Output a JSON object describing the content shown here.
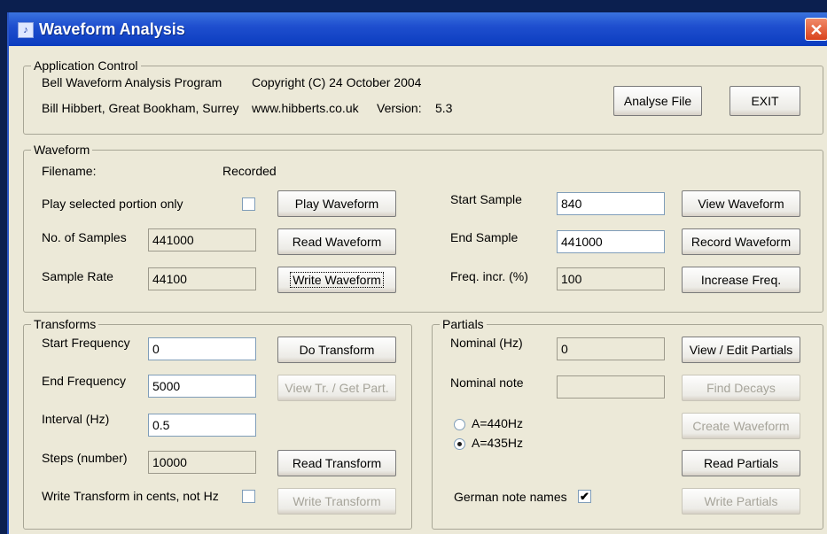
{
  "window": {
    "title": "Waveform Analysis",
    "close_glyph": "✕"
  },
  "app_control": {
    "legend": "Application Control",
    "program_name": "Bell Waveform Analysis Program",
    "copyright": "Copyright (C) 24 October 2004",
    "author": "Bill Hibbert, Great Bookham, Surrey",
    "website": "www.hibberts.co.uk",
    "version_label": "Version:",
    "version_value": "5.3",
    "analyse_button": "Analyse File",
    "exit_button": "EXIT"
  },
  "waveform": {
    "legend": "Waveform",
    "filename_label": "Filename:",
    "filename_value": "Recorded",
    "play_selected_label": "Play selected portion only",
    "play_selected_checked": false,
    "samples_label": "No. of Samples",
    "samples_value": "441000",
    "rate_label": "Sample Rate",
    "rate_value": "44100",
    "play_button": "Play Waveform",
    "read_button": "Read Waveform",
    "write_button": "Write Waveform",
    "start_label": "Start Sample",
    "start_value": "840",
    "end_label": "End Sample",
    "end_value": "441000",
    "freq_incr_label": "Freq. incr. (%)",
    "freq_incr_value": "100",
    "view_button": "View Waveform",
    "record_button": "Record Waveform",
    "increase_button": "Increase Freq."
  },
  "transforms": {
    "legend": "Transforms",
    "start_freq_label": "Start Frequency",
    "start_freq_value": "0",
    "end_freq_label": "End Frequency",
    "end_freq_value": "5000",
    "interval_label": "Interval (Hz)",
    "interval_value": "0.5",
    "steps_label": "Steps (number)",
    "steps_value": "10000",
    "cents_label": "Write Transform in cents, not Hz",
    "cents_checked": false,
    "do_button": "Do Transform",
    "view_button": "View Tr. / Get Part.",
    "read_button": "Read Transform",
    "write_button": "Write Transform"
  },
  "partials": {
    "legend": "Partials",
    "nominal_hz_label": "Nominal (Hz)",
    "nominal_hz_value": "0",
    "nominal_note_label": "Nominal note",
    "nominal_note_value": "",
    "radio_440_label": "A=440Hz",
    "radio_435_label": "A=435Hz",
    "selected_pitch": "A=435Hz",
    "german_label": "German note names",
    "german_checked": true,
    "view_edit_button": "View / Edit Partials",
    "find_decays_button": "Find Decays",
    "create_button": "Create Waveform",
    "read_button": "Read Partials",
    "write_button": "Write Partials"
  },
  "check_glyph": "✔"
}
